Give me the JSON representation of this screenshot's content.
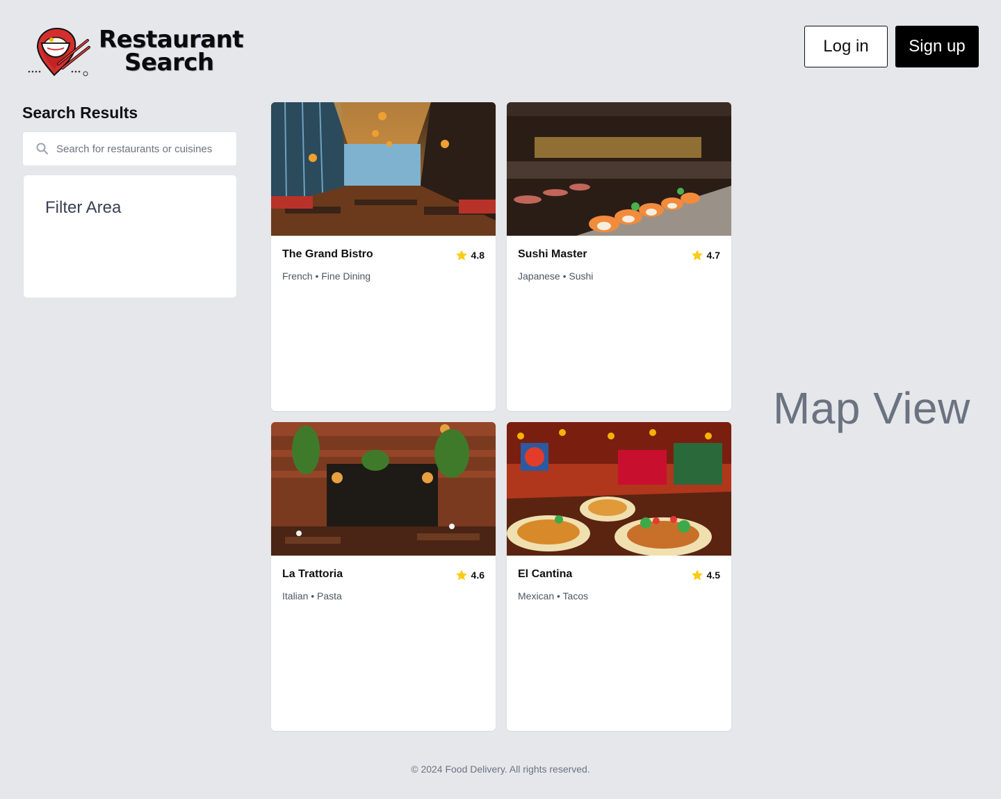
{
  "header": {
    "logo": {
      "line1": "Restaurant",
      "line2": "Search",
      "icon": "bowl-chopsticks-pin-logo"
    },
    "login_label": "Log in",
    "signup_label": "Sign up"
  },
  "sidebar": {
    "title": "Search Results",
    "search": {
      "placeholder": "Search for restaurants or cuisines",
      "value": "",
      "icon": "search-icon"
    },
    "filter_label": "Filter Area"
  },
  "restaurants": [
    {
      "name": "The Grand Bistro",
      "rating": "4.8",
      "tags": "French • Fine Dining",
      "image": "modern-bistro-interior"
    },
    {
      "name": "Sushi Master",
      "rating": "4.7",
      "tags": "Japanese • Sushi",
      "image": "sushi-bar-interior"
    },
    {
      "name": "La Trattoria",
      "rating": "4.6",
      "tags": "Italian • Pasta",
      "image": "brick-trattoria-interior"
    },
    {
      "name": "El Cantina",
      "rating": "4.5",
      "tags": "Mexican • Tacos",
      "image": "colorful-cantina-interior"
    }
  ],
  "map": {
    "label": "Map View"
  },
  "footer": {
    "text": "© 2024 Food Delivery. All rights reserved."
  },
  "colors": {
    "background": "#e5e7eb",
    "star": "#facc15",
    "primary_button": "#000000"
  }
}
